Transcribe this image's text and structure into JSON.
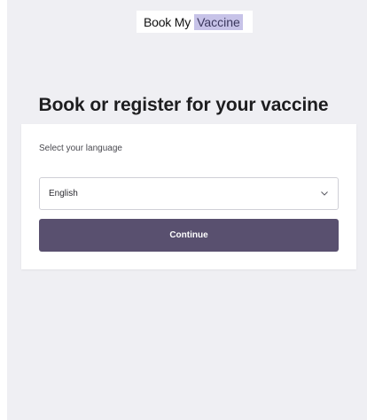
{
  "header": {
    "logo_primary": "Book My",
    "logo_highlight": "Vaccine"
  },
  "main": {
    "title": "Book or register for your vaccine",
    "language_label": "Select your language",
    "language_select": {
      "selected": "English"
    },
    "continue_label": "Continue"
  },
  "icons": {
    "select_chevron": "chevron-down-icon"
  },
  "colors": {
    "background": "#efeff3",
    "button": "#59506f",
    "logo_highlight": "#c7c3e8"
  }
}
